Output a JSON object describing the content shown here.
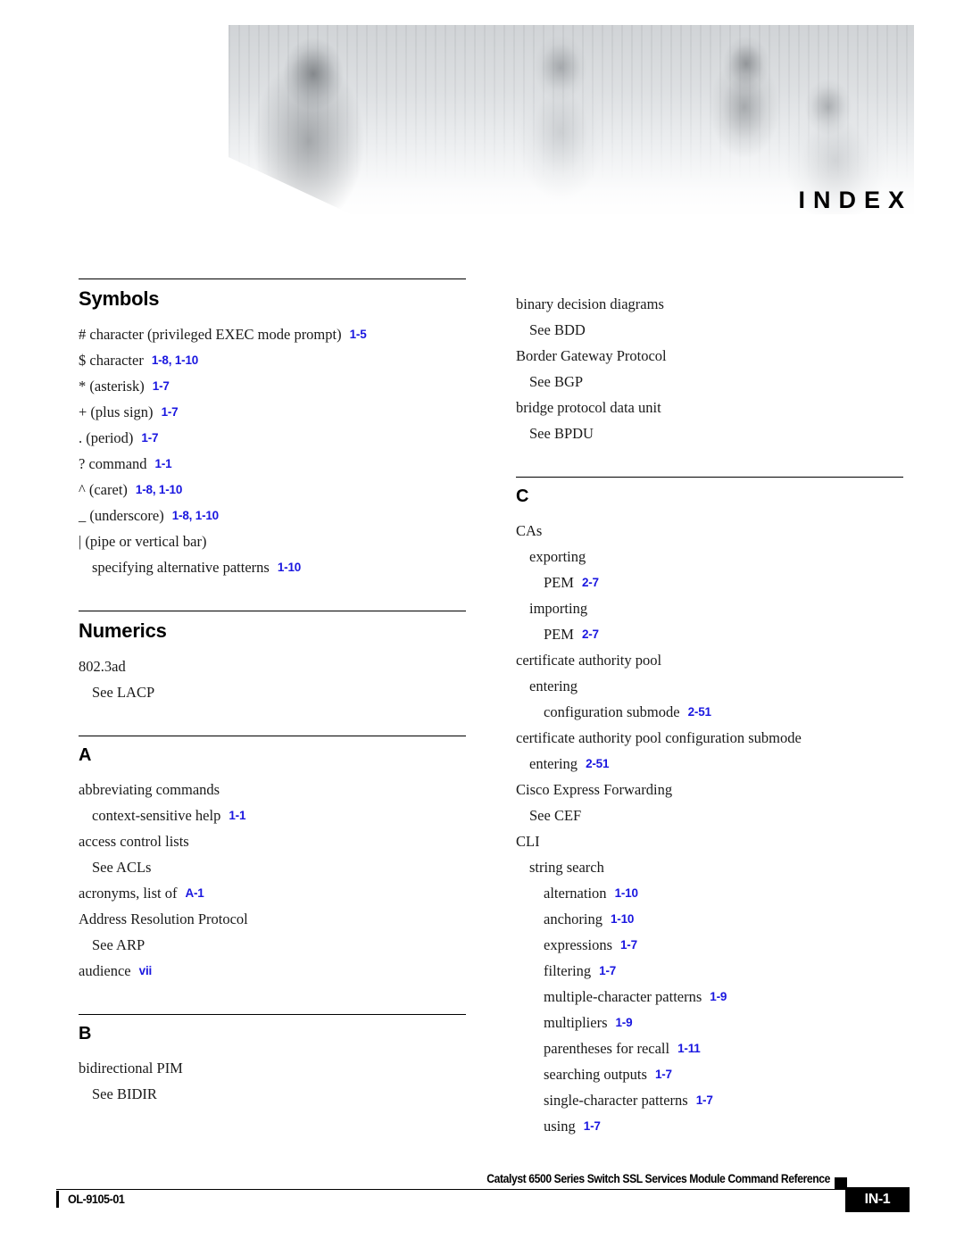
{
  "header": {
    "index_label": "INDEX",
    "banner_alt": "cisco-people-banner"
  },
  "columns": {
    "left": [
      {
        "title": "Symbols",
        "title_style": "word",
        "entries": [
          {
            "level": 0,
            "text": "# character (privileged EXEC mode prompt)",
            "ref": "1-5"
          },
          {
            "level": 0,
            "text": "$ character",
            "ref": "1-8, 1-10"
          },
          {
            "level": 0,
            "text": "* (asterisk)",
            "ref": "1-7"
          },
          {
            "level": 0,
            "text": "+ (plus sign)",
            "ref": "1-7"
          },
          {
            "level": 0,
            "text": ". (period)",
            "ref": "1-7"
          },
          {
            "level": 0,
            "text": "? command",
            "ref": "1-1"
          },
          {
            "level": 0,
            "text": "^ (caret)",
            "ref": "1-8, 1-10"
          },
          {
            "level": 0,
            "text": "_ (underscore)",
            "ref": "1-8, 1-10"
          },
          {
            "level": 0,
            "text": "| (pipe or vertical bar)",
            "ref": ""
          },
          {
            "level": 1,
            "text": "specifying alternative patterns",
            "ref": "1-10"
          }
        ]
      },
      {
        "title": "Numerics",
        "title_style": "word",
        "entries": [
          {
            "level": 0,
            "text": "802.3ad",
            "ref": ""
          },
          {
            "level": 1,
            "text": "See LACP",
            "ref": ""
          }
        ]
      },
      {
        "title": "A",
        "title_style": "letter",
        "entries": [
          {
            "level": 0,
            "text": "abbreviating commands",
            "ref": ""
          },
          {
            "level": 1,
            "text": "context-sensitive help",
            "ref": "1-1"
          },
          {
            "level": 0,
            "text": "access control lists",
            "ref": ""
          },
          {
            "level": 1,
            "text": "See ACLs",
            "ref": ""
          },
          {
            "level": 0,
            "text": "acronyms, list of",
            "ref": "A-1"
          },
          {
            "level": 0,
            "text": "Address Resolution Protocol",
            "ref": ""
          },
          {
            "level": 1,
            "text": "See ARP",
            "ref": ""
          },
          {
            "level": 0,
            "text": "audience",
            "ref": "vii"
          }
        ]
      },
      {
        "title": "B",
        "title_style": "letter",
        "entries": [
          {
            "level": 0,
            "text": "bidirectional PIM",
            "ref": ""
          },
          {
            "level": 1,
            "text": "See BIDIR",
            "ref": ""
          }
        ]
      }
    ],
    "right": [
      {
        "title": "",
        "title_style": "none",
        "entries": [
          {
            "level": 0,
            "text": "binary decision diagrams",
            "ref": ""
          },
          {
            "level": 1,
            "text": "See BDD",
            "ref": ""
          },
          {
            "level": 0,
            "text": "Border Gateway Protocol",
            "ref": ""
          },
          {
            "level": 1,
            "text": "See BGP",
            "ref": ""
          },
          {
            "level": 0,
            "text": "bridge protocol data unit",
            "ref": ""
          },
          {
            "level": 1,
            "text": "See BPDU",
            "ref": ""
          }
        ]
      },
      {
        "title": "C",
        "title_style": "letter",
        "entries": [
          {
            "level": 0,
            "text": "CAs",
            "ref": ""
          },
          {
            "level": 1,
            "text": "exporting",
            "ref": ""
          },
          {
            "level": 2,
            "text": "PEM",
            "ref": "2-7"
          },
          {
            "level": 1,
            "text": "importing",
            "ref": ""
          },
          {
            "level": 2,
            "text": "PEM",
            "ref": "2-7"
          },
          {
            "level": 0,
            "text": "certificate authority pool",
            "ref": ""
          },
          {
            "level": 1,
            "text": "entering",
            "ref": ""
          },
          {
            "level": 2,
            "text": "configuration submode",
            "ref": "2-51"
          },
          {
            "level": 0,
            "text": "certificate authority pool configuration submode",
            "ref": ""
          },
          {
            "level": 1,
            "text": "entering",
            "ref": "2-51"
          },
          {
            "level": 0,
            "text": "Cisco Express Forwarding",
            "ref": ""
          },
          {
            "level": 1,
            "text": "See CEF",
            "ref": ""
          },
          {
            "level": 0,
            "text": "CLI",
            "ref": ""
          },
          {
            "level": 1,
            "text": "string search",
            "ref": ""
          },
          {
            "level": 2,
            "text": "alternation",
            "ref": "1-10"
          },
          {
            "level": 2,
            "text": "anchoring",
            "ref": "1-10"
          },
          {
            "level": 2,
            "text": "expressions",
            "ref": "1-7"
          },
          {
            "level": 2,
            "text": "filtering",
            "ref": "1-7"
          },
          {
            "level": 2,
            "text": "multiple-character patterns",
            "ref": "1-9"
          },
          {
            "level": 2,
            "text": "multipliers",
            "ref": "1-9"
          },
          {
            "level": 2,
            "text": "parentheses for recall",
            "ref": "1-11"
          },
          {
            "level": 2,
            "text": "searching outputs",
            "ref": "1-7"
          },
          {
            "level": 2,
            "text": "single-character patterns",
            "ref": "1-7"
          },
          {
            "level": 2,
            "text": "using",
            "ref": "1-7"
          }
        ]
      }
    ]
  },
  "footer": {
    "title": "Catalyst 6500 Series Switch SSL Services Module Command Reference",
    "doc_id": "OL-9105-01",
    "page_number": "IN-1"
  },
  "colors": {
    "page_reference_blue": "#1a17e0",
    "text_black": "#000000",
    "page_background": "#ffffff"
  }
}
